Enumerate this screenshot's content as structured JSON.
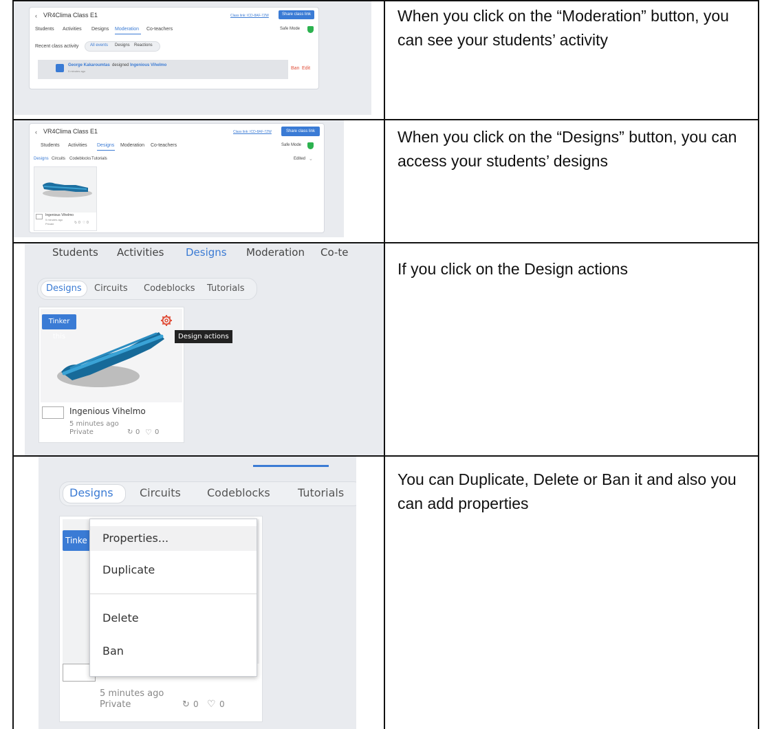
{
  "rows": [
    {
      "description": "When you click on the “Moderation” button, you can see your students’ activity",
      "screenshot": {
        "class_title": "VR4Clima Class E1",
        "class_link": "Class link: ICD-8AF-7ZW",
        "share_button": "Share class link",
        "tabs": [
          "Students",
          "Activities",
          "Designs",
          "Moderation",
          "Co-teachers"
        ],
        "active_tab": "Moderation",
        "safe_mode": "Safe Mode",
        "filter_label": "Recent class activity",
        "filters": [
          "All events",
          "Designs",
          "Reactions"
        ],
        "activity_user": "George Kakaroumtas",
        "activity_verb": "designed",
        "activity_design": "Ingenious Vihelmo",
        "activity_time": "5 minutes ago",
        "ban": "Ban",
        "edit": "Edit"
      }
    },
    {
      "description": "When you click on the “Designs” button, you can access your students’ designs",
      "screenshot": {
        "class_title": "VR4Clima Class E1",
        "class_link": "Class link: ICD-8AF-7ZW",
        "share_button": "Share class link",
        "tabs": [
          "Students",
          "Activities",
          "Designs",
          "Moderation",
          "Co-teachers"
        ],
        "active_tab": "Designs",
        "safe_mode": "Safe Mode",
        "subtabs": [
          "Designs",
          "Circuits",
          "Codeblocks",
          "Tutorials"
        ],
        "sort": "Edited",
        "design_name": "Ingenious Vihelmo",
        "design_time": "5 minutes ago",
        "design_privacy": "Private",
        "remix_count": "0",
        "like_count": "0"
      }
    },
    {
      "description": "If you click on the Design actions",
      "screenshot": {
        "tabs": [
          "Students",
          "Activities",
          "Designs",
          "Moderation",
          "Co-te"
        ],
        "active_tab": "Designs",
        "subtabs": [
          "Designs",
          "Circuits",
          "Codeblocks",
          "Tutorials"
        ],
        "tinker_button": "Tinker this",
        "tooltip": "Design actions",
        "design_name": "Ingenious Vihelmo",
        "design_time": "5 minutes ago",
        "design_privacy": "Private",
        "remix_count": "0",
        "like_count": "0"
      }
    },
    {
      "description": "You can Duplicate, Delete or Ban it and also you can add properties",
      "screenshot": {
        "subtabs": [
          "Designs",
          "Circuits",
          "Codeblocks",
          "Tutorials"
        ],
        "tinker_button_partial": "Tinke",
        "menu_items": [
          "Properties...",
          "Duplicate",
          "Delete",
          "Ban"
        ],
        "design_time": "5 minutes ago",
        "design_privacy": "Private",
        "remix_count": "0",
        "like_count": "0"
      }
    }
  ]
}
